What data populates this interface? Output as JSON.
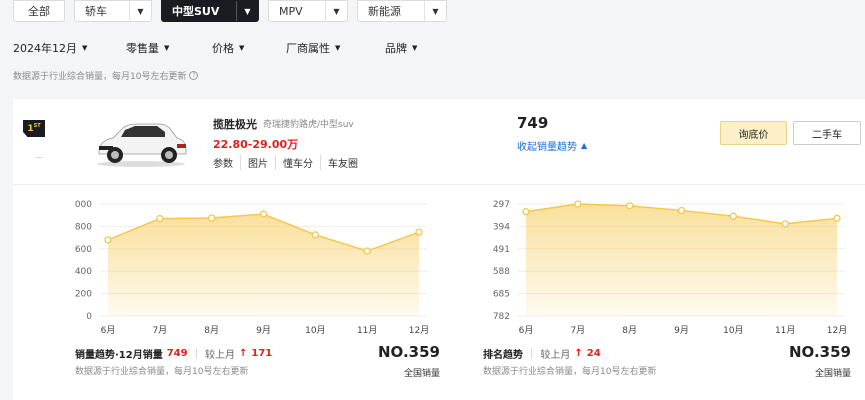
{
  "tabs": [
    {
      "label": "全部",
      "dropdown": false,
      "active": false
    },
    {
      "label": "轿车",
      "dropdown": true,
      "active": false
    },
    {
      "label": "中型SUV",
      "dropdown": true,
      "active": true
    },
    {
      "label": "MPV",
      "dropdown": true,
      "active": false
    },
    {
      "label": "新能源",
      "dropdown": true,
      "active": false
    }
  ],
  "filters": [
    "2024年12月",
    "零售量",
    "价格",
    "厂商属性",
    "品牌"
  ],
  "top_note": "数据源于行业综合销量，每月10号左右更新",
  "car": {
    "rank": "1",
    "rank_sup": "ST",
    "name": "揽胜极光",
    "category": "奇瑞捷豹路虎/中型suv",
    "price": "22.80-29.00万",
    "links": [
      "参数",
      "图片",
      "懂车分",
      "车友圈"
    ],
    "sales": "749",
    "collapse_label": "收起销量趋势",
    "quote_button": "询底价",
    "used_button": "二手车"
  },
  "sales_chart": {
    "title": "销量趋势·12月销量",
    "value": "749",
    "compare_label": "较上月",
    "change": "171",
    "note": "数据源于行业综合销量，每月10号左右更新",
    "rank": "NO.359",
    "rank_label": "全国销量"
  },
  "rank_chart": {
    "title": "排名趋势",
    "compare_label": "较上月",
    "change": "24",
    "note": "数据源于行业综合销量，每月10号左右更新",
    "rank": "NO.359",
    "rank_label": "全国销量"
  },
  "chart_data": [
    {
      "type": "area",
      "title": "",
      "categories": [
        "6月",
        "7月",
        "8月",
        "9月",
        "10月",
        "11月",
        "12月"
      ],
      "values": [
        680,
        870,
        875,
        910,
        725,
        580,
        749
      ],
      "yticks": [
        "0",
        "200",
        "400",
        "600",
        "800",
        "000"
      ],
      "ylim": [
        0,
        1000
      ],
      "color": "#f6c64a",
      "grid": true
    },
    {
      "type": "area",
      "title": "",
      "categories": [
        "6月",
        "7月",
        "8月",
        "9月",
        "10月",
        "11月",
        "12月"
      ],
      "values": [
        330,
        297,
        305,
        325,
        350,
        383,
        359
      ],
      "yticks": [
        "297",
        "394",
        "491",
        "588",
        "685",
        "782"
      ],
      "ylim": [
        297,
        782
      ],
      "inverted": true,
      "color": "#f6c64a",
      "grid": true
    }
  ],
  "colors": {
    "accent": "#f6c64a",
    "red": "#e0201d",
    "link": "#1b6fd4"
  }
}
